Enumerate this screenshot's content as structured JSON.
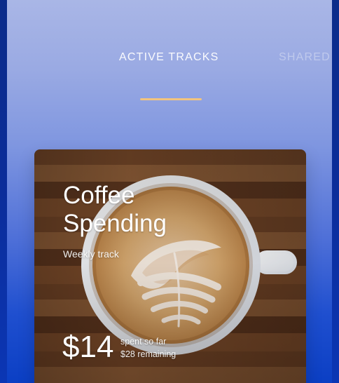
{
  "tabs": [
    {
      "label": "ACTIVE TRACKS",
      "active": true
    },
    {
      "label": "SHARED",
      "active": false
    }
  ],
  "card": {
    "title_line1": "Coffee",
    "title_line2": "Spending",
    "subtitle": "Weekly track",
    "amount": "$14",
    "spent_label": "spent so far",
    "remaining_label": "$28 remaining",
    "image_subject": "latte-art-cup-icon"
  },
  "colors": {
    "tab_indicator": "#f2c47e",
    "background_top": "#a9b6e6",
    "background_bottom": "#0b3fc4"
  }
}
